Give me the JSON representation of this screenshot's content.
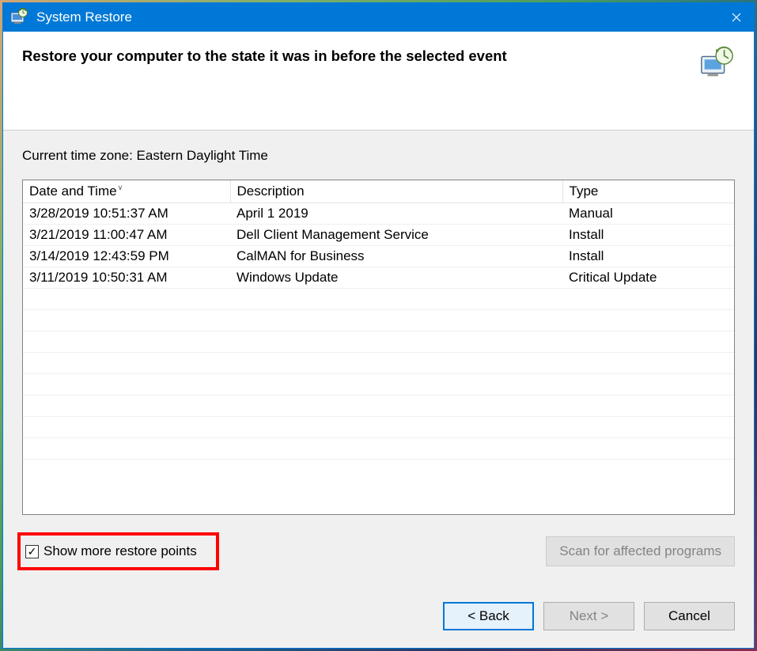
{
  "titlebar": {
    "title": "System Restore"
  },
  "header": {
    "heading": "Restore your computer to the state it was in before the selected event"
  },
  "content": {
    "timezone": "Current time zone: Eastern Daylight Time",
    "columns": {
      "date": "Date and Time",
      "description": "Description",
      "type": "Type"
    },
    "rows": [
      {
        "date": "3/28/2019 10:51:37 AM",
        "description": "April 1 2019",
        "type": "Manual"
      },
      {
        "date": "3/21/2019 11:00:47 AM",
        "description": "Dell Client Management Service",
        "type": "Install"
      },
      {
        "date": "3/14/2019 12:43:59 PM",
        "description": "CalMAN for Business",
        "type": "Install"
      },
      {
        "date": "3/11/2019 10:50:31 AM",
        "description": "Windows Update",
        "type": "Critical Update"
      }
    ],
    "checkbox": {
      "checked": true,
      "label": "Show more restore points"
    },
    "scan_button": "Scan for affected programs"
  },
  "footer": {
    "back": "< Back",
    "next": "Next >",
    "cancel": "Cancel"
  }
}
